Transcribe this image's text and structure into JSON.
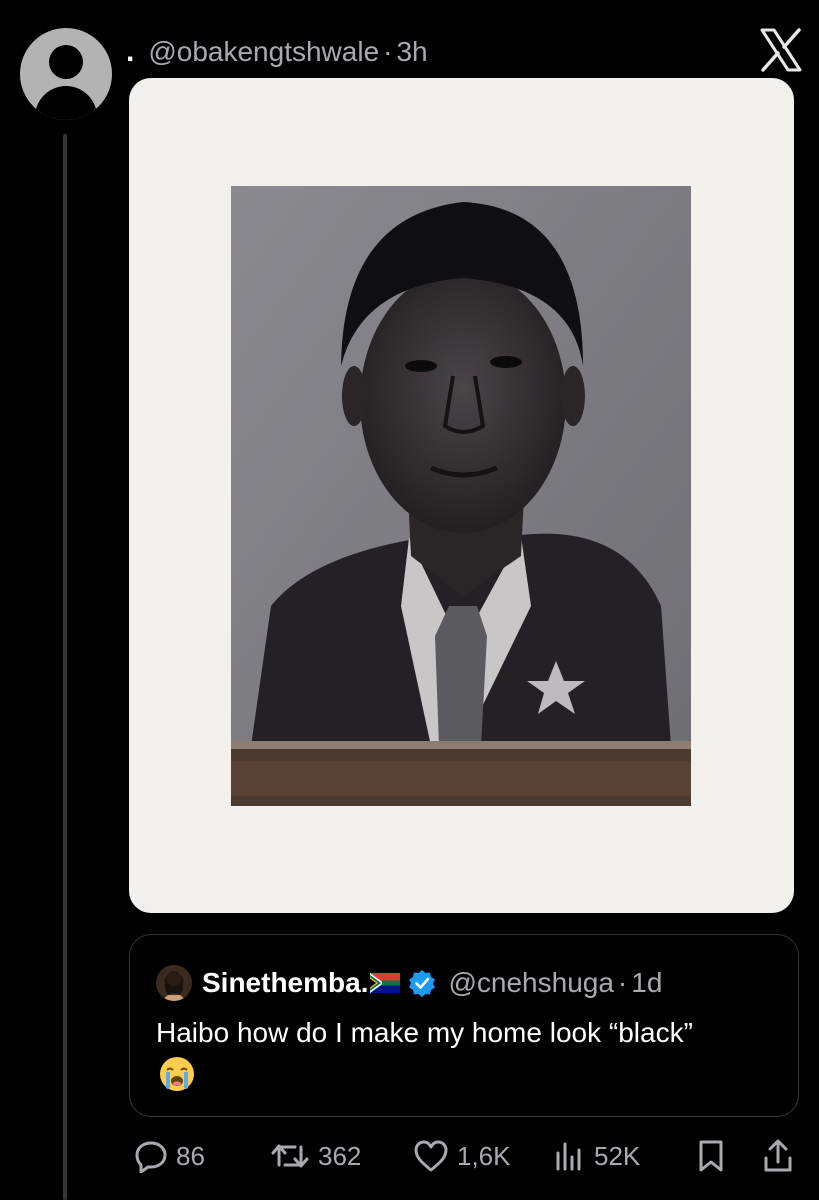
{
  "post": {
    "display_name": ".",
    "handle": "@obakengtshwale",
    "separator": "·",
    "time": "3h"
  },
  "quoted": {
    "display_name": "Sinethemba.",
    "handle": "@cnehshuga",
    "separator": "·",
    "time": "1d",
    "text": "Haibo how do I make my home look “black”",
    "emoji": "loudly-crying-face"
  },
  "actions": {
    "replies": "86",
    "reposts": "362",
    "likes": "1,6K",
    "views": "52K"
  },
  "colors": {
    "background": "#000000",
    "text": "#e7e9ea",
    "muted": "#a7abb0",
    "verified": "#1d9bf0",
    "card": "#f2f0ec"
  }
}
